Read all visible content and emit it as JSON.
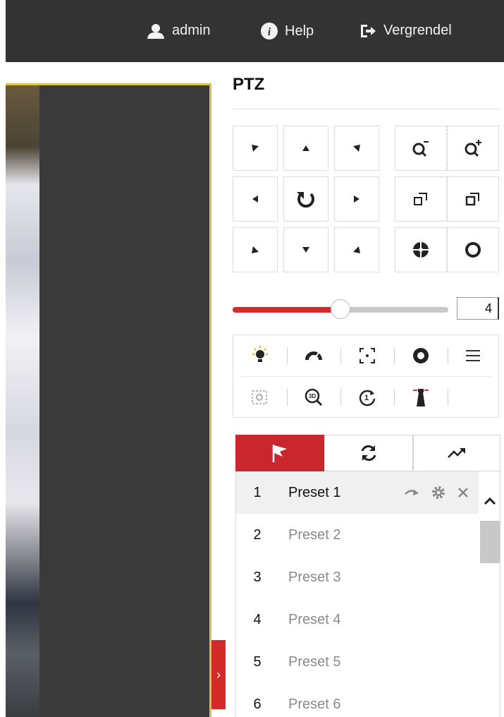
{
  "topbar": {
    "user_label": "admin",
    "help_label": "Help",
    "lock_label": "Vergrendel",
    "icons": [
      "user-icon",
      "info-icon",
      "logout-icon"
    ]
  },
  "ptz": {
    "title": "PTZ",
    "direction_buttons": [
      "up-left",
      "up",
      "up-right",
      "left",
      "auto-rotate",
      "right",
      "down-left",
      "down",
      "down-right"
    ],
    "lens_buttons": [
      "zoom-out",
      "zoom-in",
      "focus-near",
      "focus-far",
      "iris-open",
      "iris-close"
    ],
    "speed": {
      "value": "4",
      "level": 4,
      "min": 1,
      "max": 7
    },
    "functions": [
      "light",
      "wiper",
      "aux-focus",
      "lens-init",
      "menu",
      "manual-track",
      "zoom-3d",
      "park-action",
      "manual-tracking"
    ]
  },
  "tabs": [
    {
      "id": "preset",
      "icon": "flag-icon",
      "active": true
    },
    {
      "id": "patrol",
      "icon": "refresh-icon",
      "active": false
    },
    {
      "id": "pattern",
      "icon": "trend-icon",
      "active": false
    }
  ],
  "presets": [
    {
      "num": "1",
      "name": "Preset 1",
      "selected": true
    },
    {
      "num": "2",
      "name": "Preset 2",
      "selected": false
    },
    {
      "num": "3",
      "name": "Preset 3",
      "selected": false
    },
    {
      "num": "4",
      "name": "Preset 4",
      "selected": false
    },
    {
      "num": "5",
      "name": "Preset 5",
      "selected": false
    },
    {
      "num": "6",
      "name": "Preset 6",
      "selected": false
    }
  ],
  "colors": {
    "accent": "#c9262e",
    "topbar": "#333333",
    "video_border": "#d7c24a"
  }
}
